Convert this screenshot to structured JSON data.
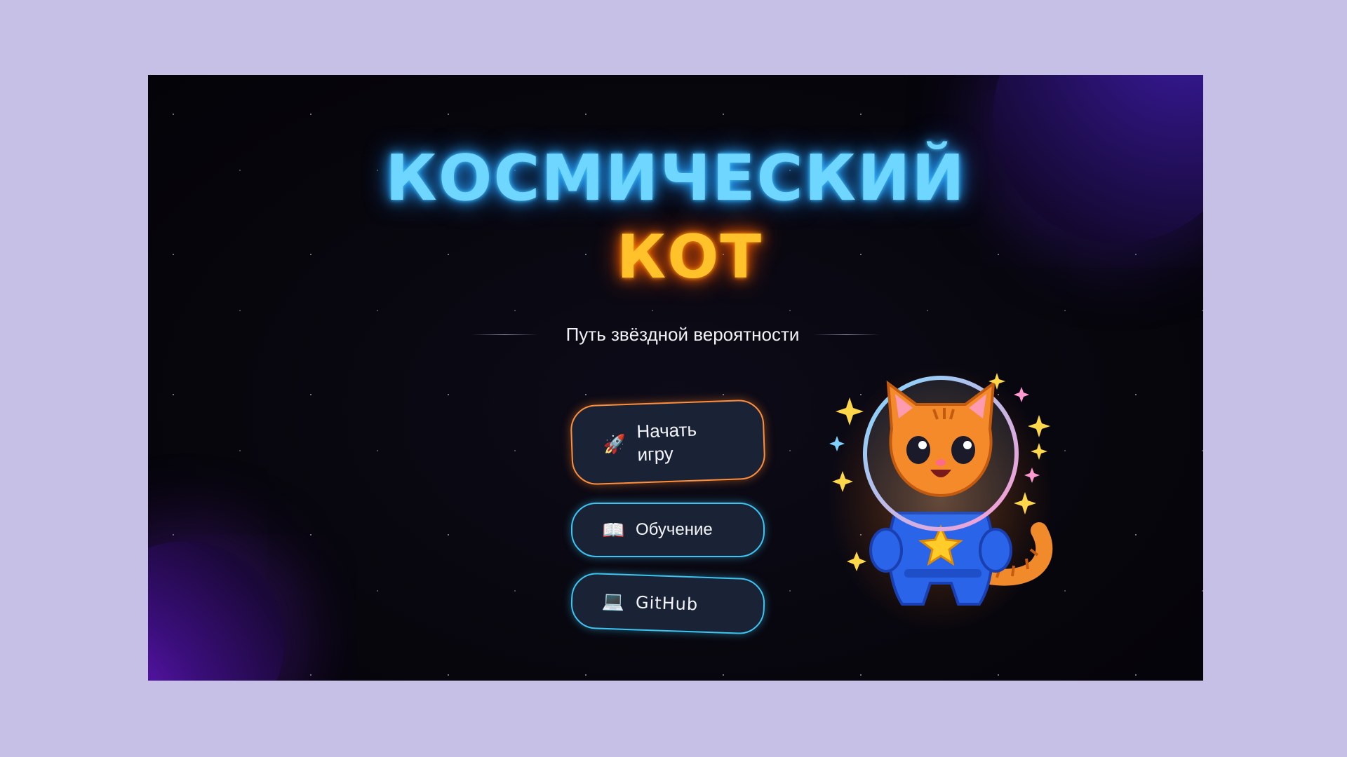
{
  "title": {
    "line1": "КОСМИЧЕСКИЙ",
    "line2": "КОТ"
  },
  "subtitle": "Путь звёздной вероятности",
  "menu": {
    "start": {
      "icon": "rocket-icon",
      "glyph": "🚀",
      "label": "Начать игру"
    },
    "tutorial": {
      "icon": "book-icon",
      "glyph": "📖",
      "label": "Обучение"
    },
    "github": {
      "icon": "laptop-icon",
      "glyph": "💻",
      "label": "GitHub"
    }
  },
  "colors": {
    "title_line1": "#6fd6ff",
    "title_line2": "#ffc22a",
    "start_border": "#ff8f3c",
    "secondary_border": "#3ec4f0",
    "background": "#07060d"
  }
}
